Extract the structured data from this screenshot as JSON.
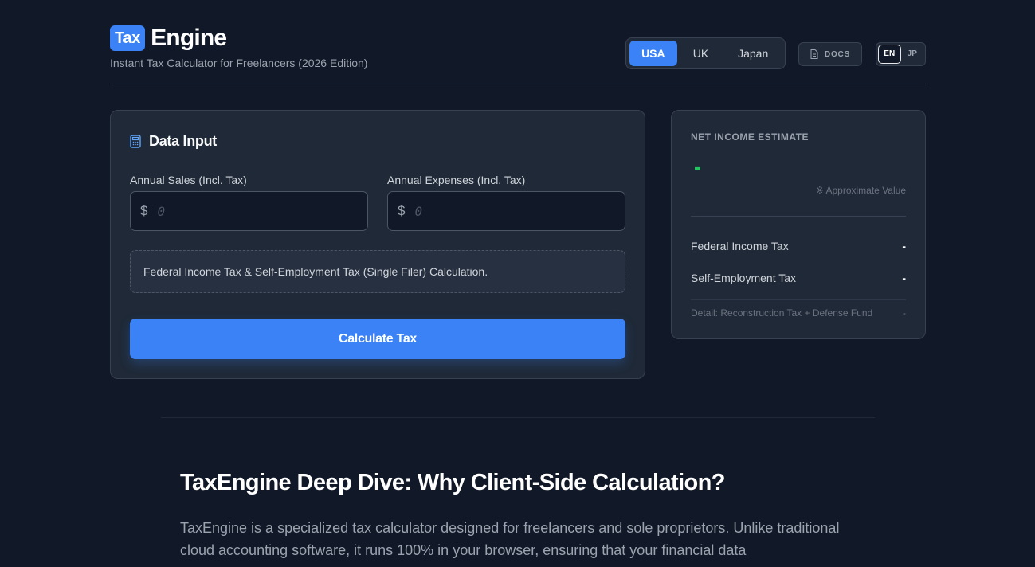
{
  "brand": {
    "badge": "Tax",
    "name": "Engine"
  },
  "subtitle": "Instant Tax Calculator for Freelancers (2026 Edition)",
  "countries": [
    {
      "label": "USA",
      "active": true
    },
    {
      "label": "UK",
      "active": false
    },
    {
      "label": "Japan",
      "active": false
    }
  ],
  "docs_label": "DOCS",
  "languages": [
    {
      "label": "EN",
      "active": true
    },
    {
      "label": "JP",
      "active": false
    }
  ],
  "input_card": {
    "title": "Data Input",
    "sales_label": "Annual Sales (Incl. Tax)",
    "expenses_label": "Annual Expenses (Incl. Tax)",
    "currency_symbol": "$",
    "sales_placeholder": "0",
    "expenses_placeholder": "0",
    "note": "Federal Income Tax & Self-Employment Tax (Single Filer) Calculation.",
    "calculate_label": "Calculate Tax"
  },
  "result_card": {
    "heading": "NET INCOME ESTIMATE",
    "value": "-",
    "approx": "※ Approximate Value",
    "rows": [
      {
        "label": "Federal Income Tax",
        "value": "-"
      },
      {
        "label": "Self-Employment Tax",
        "value": "-"
      }
    ],
    "detail_label": "Detail: Reconstruction Tax + Defense Fund",
    "detail_value": "-"
  },
  "article": {
    "title": "TaxEngine Deep Dive: Why Client-Side Calculation?",
    "body": "TaxEngine is a specialized tax calculator designed for freelancers and sole proprietors. Unlike traditional cloud accounting software, it runs 100% in your browser, ensuring that your financial data"
  },
  "colors": {
    "background": "#111827",
    "card": "#1f2937",
    "accent": "#3b82f6",
    "positive": "#22c55e"
  },
  "icons": {
    "calculator": "calculator-icon",
    "docs": "document-icon"
  }
}
